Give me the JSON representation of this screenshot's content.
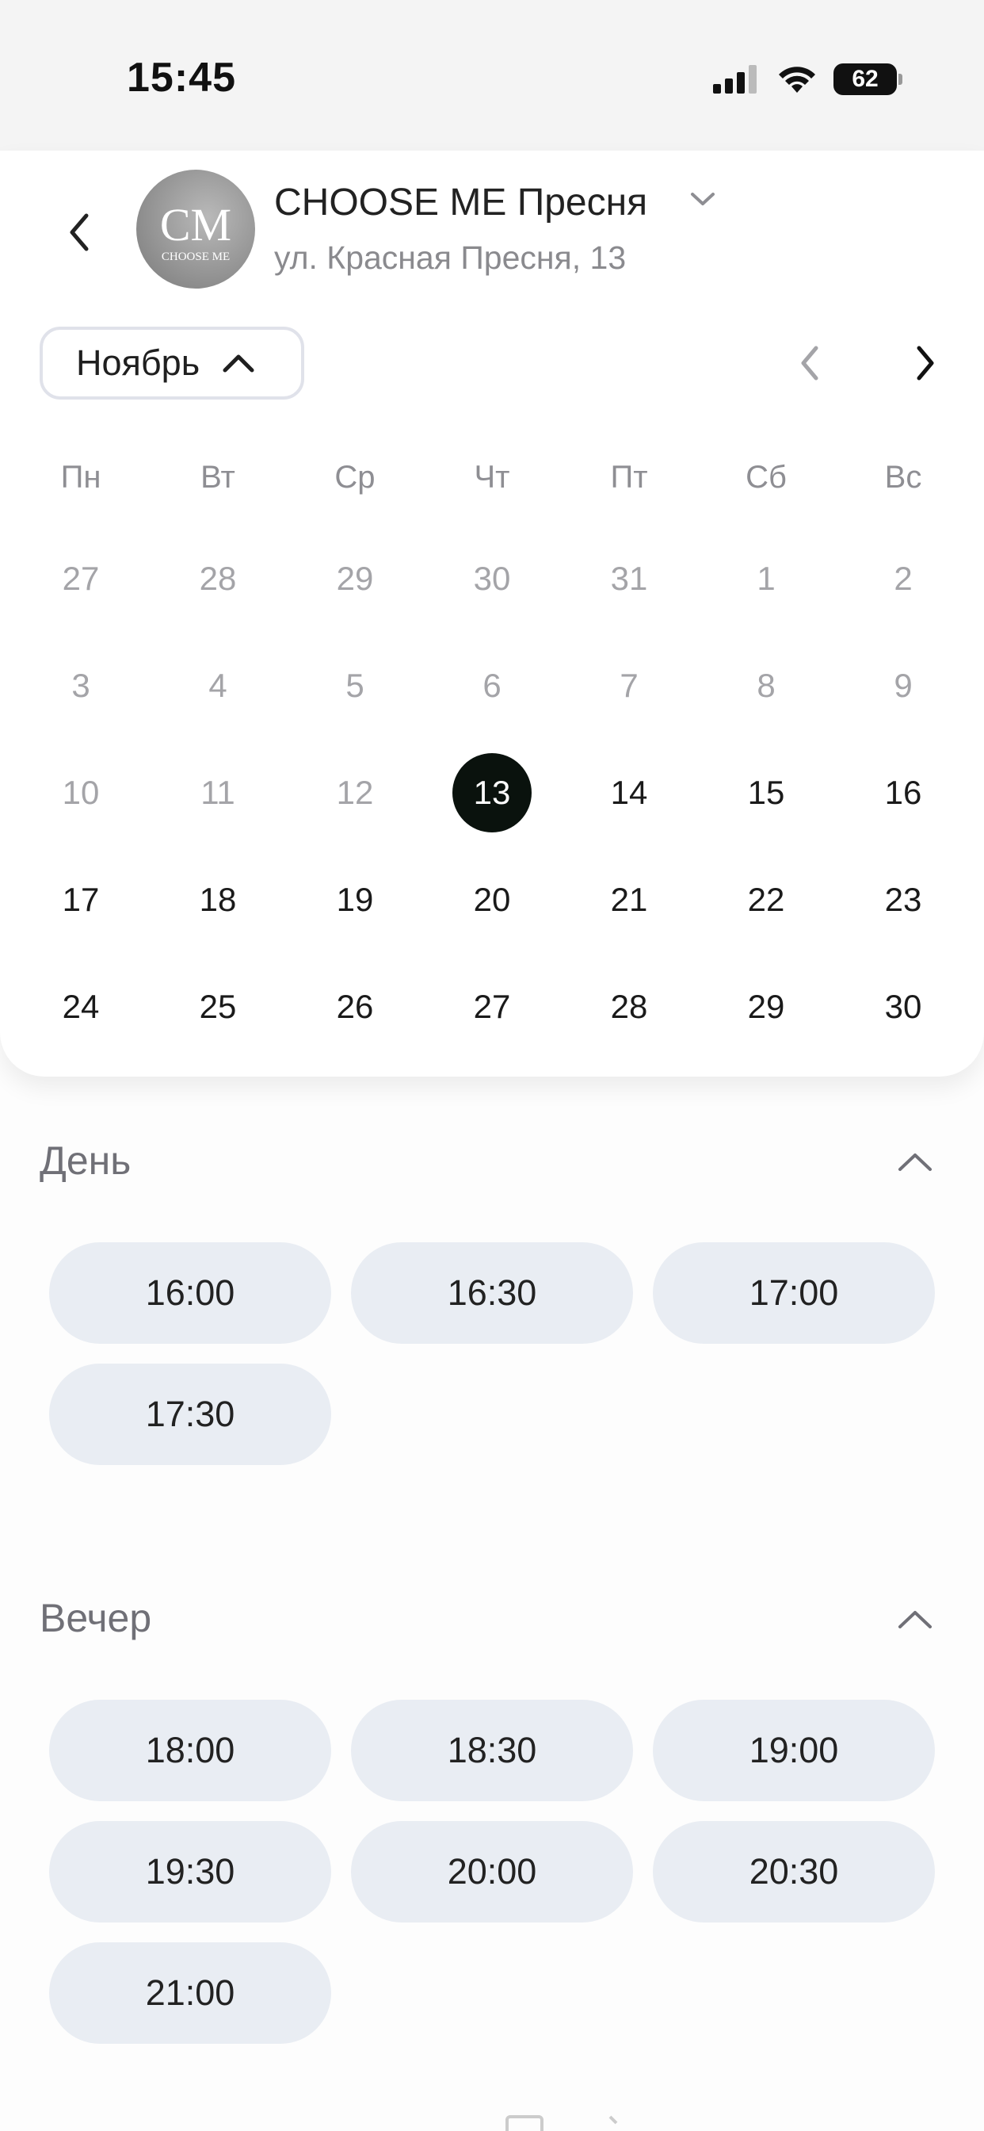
{
  "status_bar": {
    "time": "15:45",
    "battery": "62"
  },
  "salon": {
    "name": "CHOOSE ME Пресня",
    "address": "ул. Красная Пресня, 13",
    "logo_monogram": "CM",
    "logo_text": "CHOOSE ME"
  },
  "calendar": {
    "month": "Ноябрь",
    "weekdays": [
      "Пн",
      "Вт",
      "Ср",
      "Чт",
      "Пт",
      "Сб",
      "Вс"
    ],
    "weeks": [
      [
        "27",
        "28",
        "29",
        "30",
        "31",
        "1",
        "2"
      ],
      [
        "3",
        "4",
        "5",
        "6",
        "7",
        "8",
        "9"
      ],
      [
        "10",
        "11",
        "12",
        "13",
        "14",
        "15",
        "16"
      ],
      [
        "17",
        "18",
        "19",
        "20",
        "21",
        "22",
        "23"
      ],
      [
        "24",
        "25",
        "26",
        "27",
        "28",
        "29",
        "30"
      ]
    ],
    "selected": "13"
  },
  "sections": [
    {
      "title": "День",
      "slots": [
        "16:00",
        "16:30",
        "17:00",
        "17:30"
      ]
    },
    {
      "title": "Вечер",
      "slots": [
        "18:00",
        "18:30",
        "19:00",
        "19:30",
        "20:00",
        "20:30",
        "21:00"
      ]
    }
  ],
  "colors": {
    "selected_day": "#0a120d",
    "slot_bg": "#e9edf3",
    "muted_text": "#a4a4a8"
  },
  "icons": {
    "back": "chevron-left-icon",
    "dropdown": "chevron-down-icon",
    "month_toggle": "chevron-up-icon",
    "prev": "chevron-left-icon",
    "next": "chevron-right-icon",
    "collapse": "chevron-up-icon"
  }
}
